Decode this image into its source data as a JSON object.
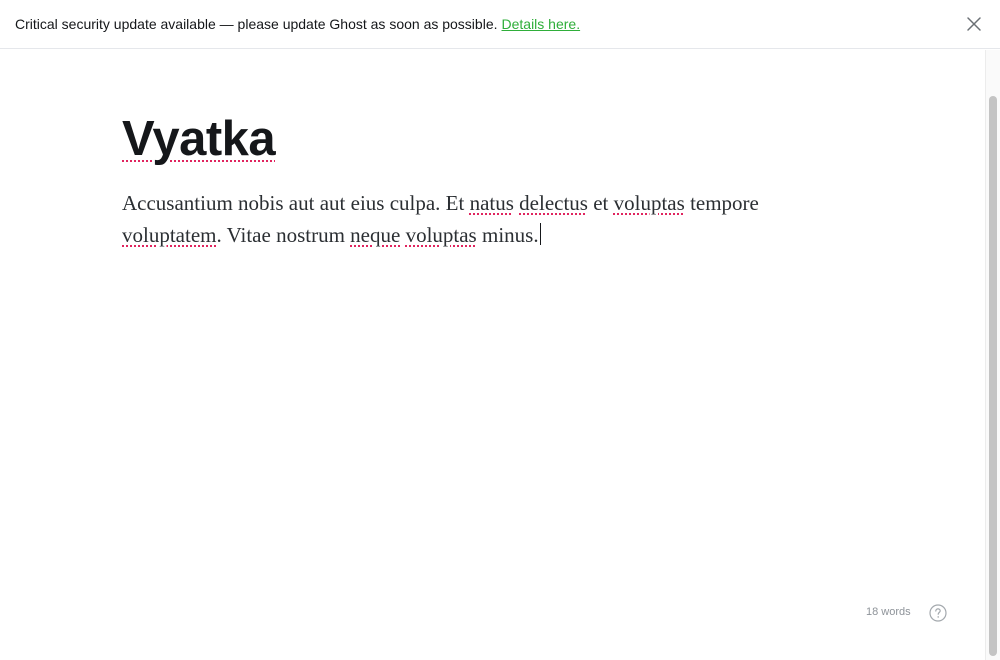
{
  "banner": {
    "message": "Critical security update available — please update Ghost as soon as possible.",
    "link_label": "Details here.",
    "link_color": "#2fae3a",
    "close_icon": "close-icon"
  },
  "editor": {
    "title": "Vyatka",
    "body": {
      "s1": "Accusantium nobis aut aut eius culpa. Et ",
      "w1": "natus",
      "s2": " ",
      "w2": "delectus",
      "s3": " et ",
      "w3": "voluptas",
      "s4": " tempore ",
      "w4": "voluptatem",
      "s5": ". Vitae nostrum ",
      "w5": "neque",
      "s6": " ",
      "w6": "voluptas",
      "s7": " minus."
    },
    "spellcheck_color": "#e0245e"
  },
  "footer": {
    "word_count": "18 words",
    "help_icon": "help-circle-icon"
  }
}
